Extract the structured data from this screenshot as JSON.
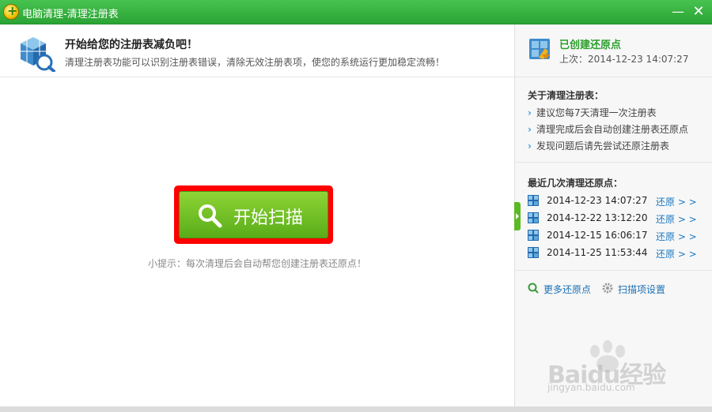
{
  "window": {
    "title": "电脑清理-清理注册表",
    "min_symbol": "—",
    "close_symbol": "✕"
  },
  "header": {
    "title": "开始给您的注册表减负吧！",
    "description": "清理注册表功能可以识别注册表错误，清除无效注册表项，使您的系统运行更加稳定流畅！"
  },
  "main": {
    "scan_button_label": "开始扫描",
    "tip": "小提示：每次清理后会自动帮您创建注册表还原点！"
  },
  "sidebar": {
    "status_title": "已创建还原点",
    "status_time": "上次：2014-12-23 14:07:27",
    "about_title": "关于清理注册表：",
    "about_items": [
      "建议您每7天清理一次注册表",
      "清理完成后会自动创建注册表还原点",
      "发现问题后请先尝试还原注册表"
    ],
    "recent_title": "最近几次清理还原点：",
    "restore_points": [
      {
        "date": "2014-12-23 14:07:27",
        "action": "还原 > >"
      },
      {
        "date": "2014-12-22 13:12:20",
        "action": "还原 > >"
      },
      {
        "date": "2014-12-15 16:06:17",
        "action": "还原 > >"
      },
      {
        "date": "2014-11-25 11:53:44",
        "action": "还原 > >"
      }
    ],
    "more_link": "更多还原点",
    "settings_link": "扫描项设置"
  },
  "watermark": {
    "brand": "Baidu经验",
    "url": "jingyan.baidu.com"
  },
  "colors": {
    "titlebar": "#2aa434",
    "scan_button": "#6cbf22",
    "highlight_frame": "#ff0000",
    "link": "#1a78c2",
    "status_green": "#2c9e2c"
  },
  "icons": {
    "app": "app-logo-icon",
    "registry": "registry-cube-icon",
    "restore": "restore-point-icon",
    "search": "search-icon",
    "grid": "registry-grid-icon",
    "more": "magnifier-plus-icon",
    "settings": "gear-icon"
  }
}
